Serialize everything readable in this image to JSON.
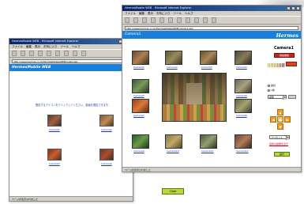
{
  "back_window": {
    "title": "HermesMobile WEB - Microsoft Internet Explorer",
    "menu": [
      "ファイル",
      "編集",
      "表示",
      "お気に入り",
      "ツール",
      "ヘルプ"
    ],
    "address": "http://www.hermes.co.jp/HermesMobileWEB/index.asp",
    "banner": "HermesMobile WEB",
    "note": "閲覧するアイコンをクリックしてください。動画を閲覧できます。",
    "cameras": [
      {
        "label": "Camera1"
      },
      {
        "label": "Camera2"
      },
      {
        "label": "Camera3"
      },
      {
        "label": "Camera4"
      }
    ],
    "status": "ページが表示されました"
  },
  "front_window": {
    "title": "HermesMobile WEB - Microsoft Internet Explorer",
    "menu": [
      "ファイル",
      "編集",
      "表示",
      "お気に入り",
      "ツール",
      "ヘルプ"
    ],
    "address": "http://www.hermes.co.jp/HermesMobileWEB/camera.asp",
    "banner": "Camera1",
    "logo": "Hermes",
    "thumbnails": [
      {
        "label": "Camera1"
      },
      {
        "label": "Camera2"
      },
      {
        "label": "Camera3"
      },
      {
        "label": "Camera4"
      },
      {
        "label": "Camera5"
      },
      {
        "label": "Camera6"
      },
      {
        "label": "Camera7"
      },
      {
        "label": "Camera8"
      },
      {
        "label": "Camera9"
      },
      {
        "label": "Camera10"
      },
      {
        "label": "Camera11"
      },
      {
        "label": "Camera12"
      }
    ],
    "panel": {
      "title": "Camera1",
      "record_button": "録画開始",
      "radio_options": [
        "連続",
        "1枚"
      ],
      "select_value": "標準",
      "preset_select": "プリセット",
      "link": "最新の画像を表示",
      "ok_button": "実行"
    },
    "status": "ページが表示されました"
  },
  "outside_button": "Close",
  "colors": {
    "banner": "#1a7fd8",
    "title_gradient_start": "#0a246a",
    "record_button": "#c8251c",
    "dpad": "#f0a020",
    "green_button": "#b8d83c"
  }
}
